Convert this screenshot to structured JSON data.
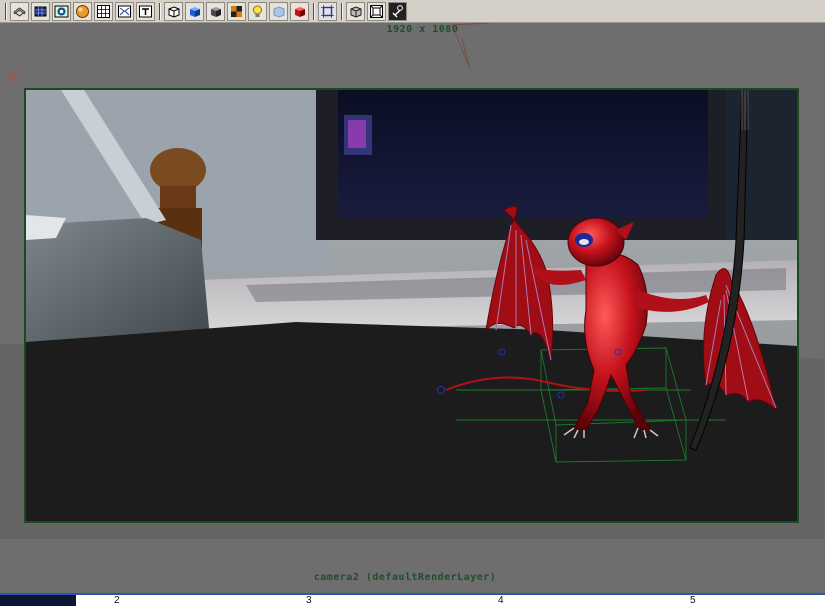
{
  "toolbar": {
    "icons": [
      "camera-attributes-icon",
      "wireframe-icon",
      "smooth-shade-icon",
      "shaded-icon",
      "grid-icon",
      "texture-icon",
      "text-icon",
      "isolate-cube-icon",
      "blue-cube-icon",
      "dark-cube-icon",
      "checker-icon",
      "light-bulb-icon",
      "xray-cube-icon",
      "red-cube-icon",
      "frame-select-icon",
      "resolution-gate-icon",
      "film-gate-icon",
      "pivot-icon"
    ]
  },
  "viewport": {
    "resolution": "1920 x 1080",
    "camera_label": "camera2 (defaultRenderLayer)"
  },
  "timeline": {
    "frames": [
      "2",
      "3",
      "4",
      "5"
    ]
  },
  "colors": {
    "gate_border": "#1a4a20",
    "label_text": "#1f4e2c",
    "character_red": "#b3111a",
    "timeline_accent": "#2c54b0"
  }
}
